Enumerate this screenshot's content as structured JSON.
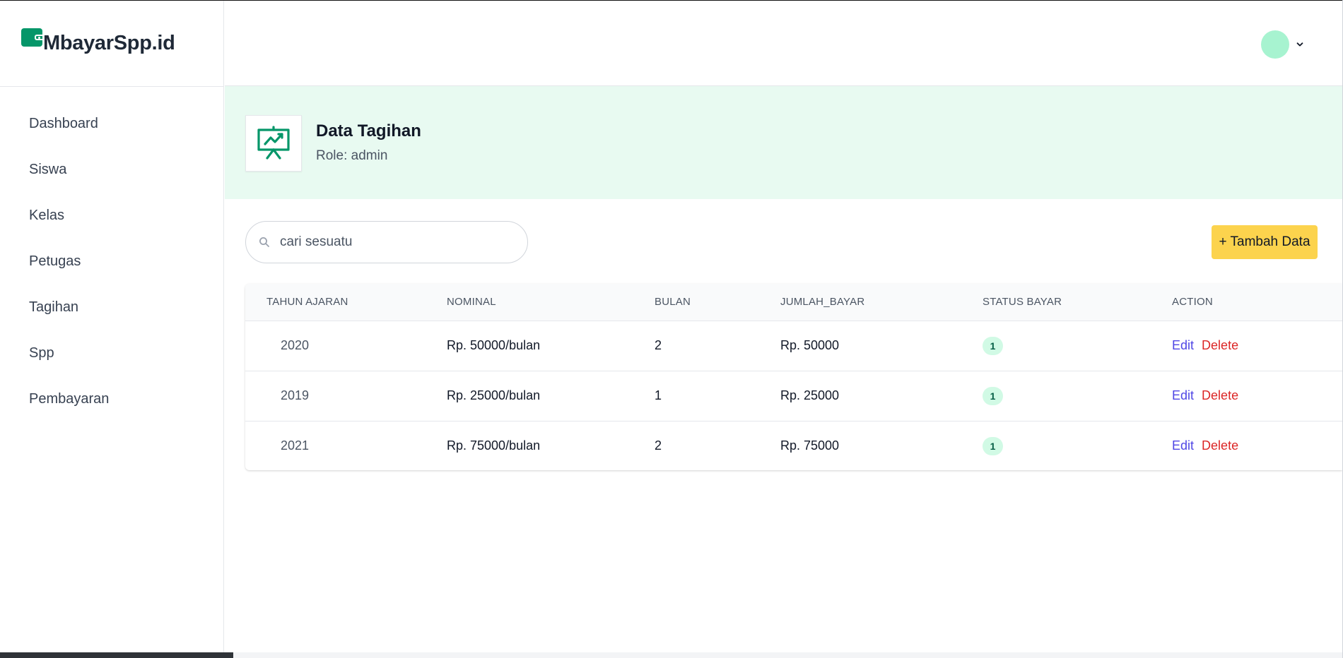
{
  "brand": {
    "name": "MbayarSpp.id",
    "icon": "wallet-icon",
    "accent": "#059669"
  },
  "sidebar": {
    "items": [
      {
        "label": "Dashboard"
      },
      {
        "label": "Siswa"
      },
      {
        "label": "Kelas"
      },
      {
        "label": "Petugas"
      },
      {
        "label": "Tagihan"
      },
      {
        "label": "Spp"
      },
      {
        "label": "Pembayaran"
      }
    ]
  },
  "header": {
    "avatar_color": "#a7f3d0",
    "menu_icon": "chevron-down-icon"
  },
  "page": {
    "title": "Data Tagihan",
    "role": "Role: admin",
    "icon": "presentation-chart-icon",
    "band_color": "#e8faf1"
  },
  "toolbar": {
    "search_placeholder": "cari sesuatu",
    "search_icon": "search-icon",
    "add_label": "+ Tambah Data",
    "add_color": "#fcd34d"
  },
  "table": {
    "headers": {
      "tahun": "TAHUN AJARAN",
      "nominal": "NOMINAL",
      "bulan": "BULAN",
      "jumlah": "JUMLAH_BAYAR",
      "status": "STATUS BAYAR",
      "action": "ACTION"
    },
    "rows": [
      {
        "tahun": "2020",
        "nominal": "Rp. 50000/bulan",
        "bulan": "2",
        "jumlah": "Rp. 50000",
        "status": "1",
        "edit": "Edit",
        "delete": "Delete"
      },
      {
        "tahun": "2019",
        "nominal": "Rp. 25000/bulan",
        "bulan": "1",
        "jumlah": "Rp. 25000",
        "status": "1",
        "edit": "Edit",
        "delete": "Delete"
      },
      {
        "tahun": "2021",
        "nominal": "Rp. 75000/bulan",
        "bulan": "2",
        "jumlah": "Rp. 75000",
        "status": "1",
        "edit": "Edit",
        "delete": "Delete"
      }
    ]
  }
}
